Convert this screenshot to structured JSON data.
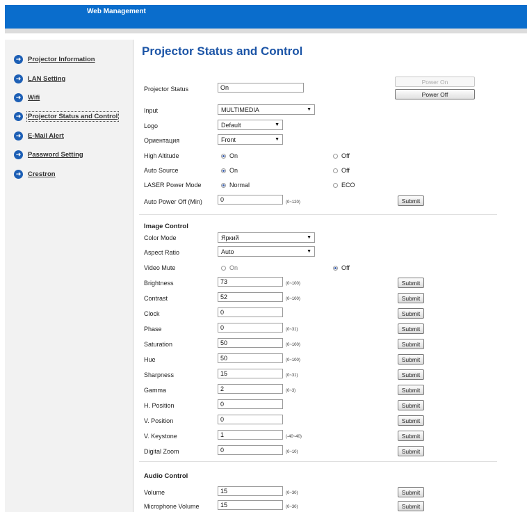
{
  "header": {
    "title": "Web Management"
  },
  "sidebar": {
    "items": [
      {
        "label": "Projector Information"
      },
      {
        "label": "LAN Setting"
      },
      {
        "label": "Wifi"
      },
      {
        "label": "Projector Status and Control"
      },
      {
        "label": "E-Mail Alert"
      },
      {
        "label": "Password Setting"
      },
      {
        "label": "Crestron"
      }
    ]
  },
  "main": {
    "title": "Projector Status and Control",
    "projector_status": {
      "label": "Projector Status",
      "value": "On",
      "power_on": "Power On",
      "power_off": "Power Off"
    },
    "input": {
      "label": "Input",
      "value": "MULTIMEDIA"
    },
    "logo": {
      "label": "Logo",
      "value": "Default"
    },
    "orientation": {
      "label": "Ориентация",
      "value": "Front"
    },
    "high_altitude": {
      "label": "High Altitude",
      "opt_on": "On",
      "opt_off": "Off",
      "selected": "On"
    },
    "auto_source": {
      "label": "Auto Source",
      "opt_on": "On",
      "opt_off": "Off",
      "selected": "On"
    },
    "laser_power": {
      "label": "LASER Power Mode",
      "opt_a": "Normal",
      "opt_b": "ECO",
      "selected": "Normal"
    },
    "auto_power_off": {
      "label": "Auto Power Off (Min)",
      "value": "0",
      "range": "(0~120)",
      "submit": "Submit"
    },
    "image_control": {
      "heading": "Image Control",
      "color_mode": {
        "label": "Color Mode",
        "value": "Яркий"
      },
      "aspect_ratio": {
        "label": "Aspect Ratio",
        "value": "Auto"
      },
      "video_mute": {
        "label": "Video Mute",
        "opt_on": "On",
        "opt_off": "Off",
        "selected": "Off"
      },
      "rows": [
        {
          "label": "Brightness",
          "value": "73",
          "range": "(0~100)",
          "submit": "Submit"
        },
        {
          "label": "Contrast",
          "value": "52",
          "range": "(0~100)",
          "submit": "Submit"
        },
        {
          "label": "Clock",
          "value": "0",
          "range": "",
          "submit": "Submit"
        },
        {
          "label": "Phase",
          "value": "0",
          "range": "(0~31)",
          "submit": "Submit"
        },
        {
          "label": "Saturation",
          "value": "50",
          "range": "(0~100)",
          "submit": "Submit"
        },
        {
          "label": "Hue",
          "value": "50",
          "range": "(0~100)",
          "submit": "Submit"
        },
        {
          "label": "Sharpness",
          "value": "15",
          "range": "(0~31)",
          "submit": "Submit"
        },
        {
          "label": "Gamma",
          "value": "2",
          "range": "(0~3)",
          "submit": "Submit"
        },
        {
          "label": "H. Position",
          "value": "0",
          "range": "",
          "submit": "Submit"
        },
        {
          "label": "V. Position",
          "value": "0",
          "range": "",
          "submit": "Submit"
        },
        {
          "label": "V. Keystone",
          "value": "1",
          "range": "(-40~40)",
          "submit": "Submit"
        },
        {
          "label": "Digital Zoom",
          "value": "0",
          "range": "(0~10)",
          "submit": "Submit"
        }
      ]
    },
    "audio_control": {
      "heading": "Audio Control",
      "rows": [
        {
          "label": "Volume",
          "value": "15",
          "range": "(0~30)",
          "submit": "Submit"
        },
        {
          "label": "Microphone Volume",
          "value": "15",
          "range": "(0~30)",
          "submit": "Submit"
        }
      ]
    }
  },
  "colors": {
    "header": "#0a6dcc",
    "title": "#1b54a6",
    "nav_icon": "#1d5fb5"
  },
  "icons": {
    "nav": "arrow-circle-icon",
    "select": "caret-down-icon",
    "radio": "radio-icon"
  }
}
